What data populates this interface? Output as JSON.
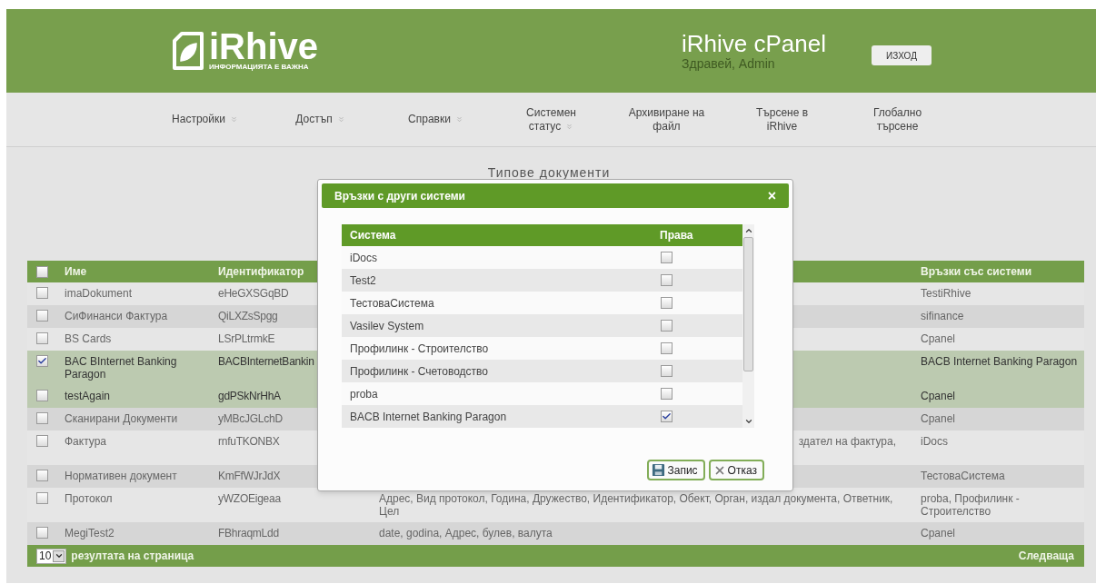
{
  "header": {
    "logo": {
      "name": "iRhive",
      "tagline": "ИНФОРМАЦИЯТА Е ВАЖНА"
    },
    "title": "iRhive cPanel",
    "greeting": "Здравей, Admin",
    "logout_button": "ИЗХОД"
  },
  "nav": [
    {
      "label": "Настройки",
      "dropdown": true
    },
    {
      "label": "Достъп",
      "dropdown": true
    },
    {
      "label": "Справки",
      "dropdown": true
    },
    {
      "label": "Системен статус",
      "dropdown": true
    },
    {
      "label": "Архивиране на файл",
      "dropdown": false
    },
    {
      "label": "Търсене в iRhive",
      "dropdown": false
    },
    {
      "label": "Глобално търсене",
      "dropdown": false
    }
  ],
  "page_title": "Типове документи",
  "table": {
    "select_all_checked": false,
    "columns": [
      "Име",
      "Идентификатор",
      "Връзки със системи"
    ],
    "rows": [
      {
        "name": "imaDokument",
        "id": "eHeGXSGqBD",
        "links": "TestiRhive",
        "checked": false,
        "selected": false
      },
      {
        "name": "СиФинанси Фактура",
        "id": "QiLXZsSpgg",
        "links": "sifinance",
        "checked": false,
        "selected": false
      },
      {
        "name": "BS Cards",
        "id": "LSrPLtrmkE",
        "links": "Cpanel",
        "checked": false,
        "selected": false
      },
      {
        "name": "BAC BInternet Banking Paragon",
        "id": "BACBInternetBankin",
        "links": "BACB Internet Banking Paragon",
        "checked": true,
        "selected": true
      },
      {
        "name": "testAgain",
        "id": "gdPSkNrHhA",
        "links": "Cpanel",
        "checked": false,
        "selected": true
      },
      {
        "name": "Сканирани Документи",
        "id": "yMBcJGLchD",
        "links": "Cpanel",
        "checked": false,
        "selected": false
      },
      {
        "name": "Фактура",
        "id": "rnfuTKONBX",
        "column_3": "здател на фактура,",
        "column_3_cut": true,
        "links": "iDocs",
        "checked": false,
        "selected": false
      },
      {
        "name": "Нормативен документ",
        "id": "KmFfWJrJdX",
        "links": "ТестоваСистема",
        "checked": false,
        "selected": false
      },
      {
        "name": "Протокол",
        "id": "yWZOEigeaa",
        "column_3": "Адрес, Вид протокол, Година, Дружество, Идентификатор, Обект, Орган, издал документа, Ответник, Цел",
        "column_3_cut": false,
        "links": "proba, Профилинк - Строителство",
        "checked": false,
        "selected": false
      },
      {
        "name": "MegiTest2",
        "id": "FBhraqmLdd",
        "column_3": "date, godina, Адрес, булев, валута",
        "column_3_cut": false,
        "links": "Cpanel",
        "checked": false,
        "selected": false
      }
    ],
    "footer": {
      "page_size": "10",
      "page_size_label": "резултата на страница",
      "next": "Следваща"
    }
  },
  "dialog": {
    "title": "Връзки с други системи",
    "close": "×",
    "columns": [
      "Система",
      "Права"
    ],
    "rows": [
      {
        "system": "iDocs",
        "checked": false
      },
      {
        "system": "Test2",
        "checked": false
      },
      {
        "system": "ТестоваСистема",
        "checked": false
      },
      {
        "system": "Vasilev System",
        "checked": false
      },
      {
        "system": "Профилинк - Строителство",
        "checked": false
      },
      {
        "system": "Профилинк - Счетоводство",
        "checked": false
      },
      {
        "system": "proba",
        "checked": false
      },
      {
        "system": "BACB Internet Banking Paragon",
        "checked": true
      }
    ],
    "buttons": [
      {
        "label": "Запис",
        "kind": "save"
      },
      {
        "label": "Отказ",
        "kind": "cancel"
      }
    ]
  }
}
